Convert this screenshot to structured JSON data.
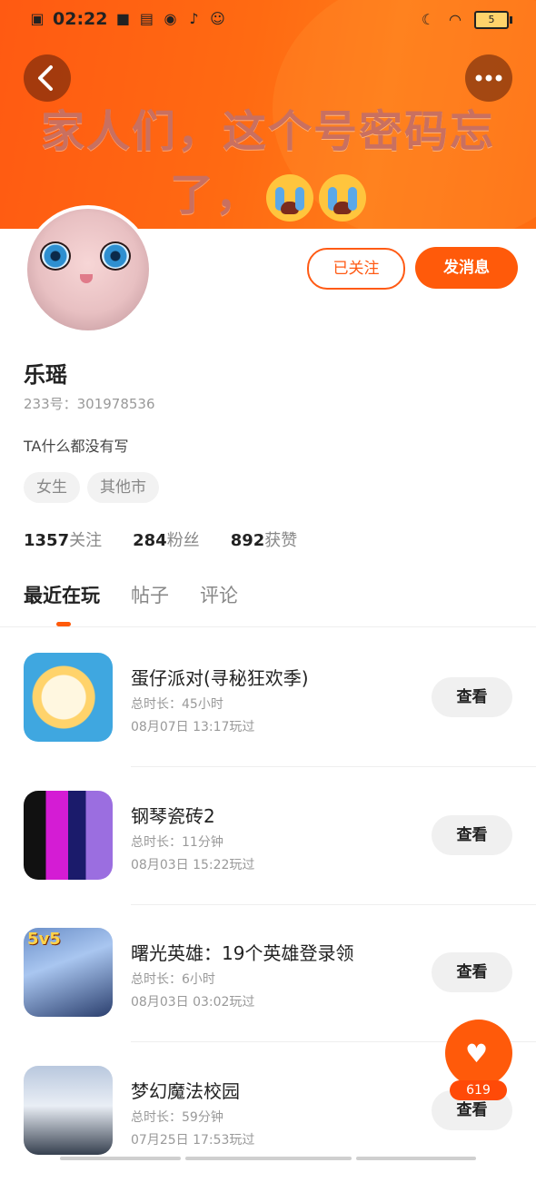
{
  "status_bar": {
    "time": "02:22",
    "battery": "5"
  },
  "header": {
    "overlay_line1": "家人们，这个号密码忘",
    "overlay_line2": "了，",
    "back_icon": "back-arrow-icon",
    "more_icon": "more-dots-icon"
  },
  "profile": {
    "follow_label": "已关注",
    "message_label": "发消息",
    "name": "乐瑶",
    "uid": "233号：301978536",
    "bio": "TA什么都没有写",
    "tags": [
      "女生",
      "其他市"
    ],
    "stats": [
      {
        "value": "1357",
        "label": "关注"
      },
      {
        "value": "284",
        "label": "粉丝"
      },
      {
        "value": "892",
        "label": "获赞"
      }
    ]
  },
  "tabs": [
    "最近在玩",
    "帖子",
    "评论"
  ],
  "games": [
    {
      "title": "蛋仔派对(寻秘狂欢季)",
      "duration": "总时长：45小时",
      "played": "08月07日 13:17玩过",
      "button": "查看"
    },
    {
      "title": "钢琴瓷砖2",
      "duration": "总时长：11分钟",
      "played": "08月03日 15:22玩过",
      "button": "查看"
    },
    {
      "title": "曙光英雄：19个英雄登录领",
      "duration": "总时长：6小时",
      "played": "08月03日 03:02玩过",
      "button": "查看",
      "icon_badge": "5v5"
    },
    {
      "title": "梦幻魔法校园",
      "duration": "总时长：59分钟",
      "played": "07月25日 17:53玩过",
      "button": "查看"
    }
  ],
  "fab": {
    "count": "619"
  },
  "colors": {
    "accent": "#ff5a0a"
  }
}
